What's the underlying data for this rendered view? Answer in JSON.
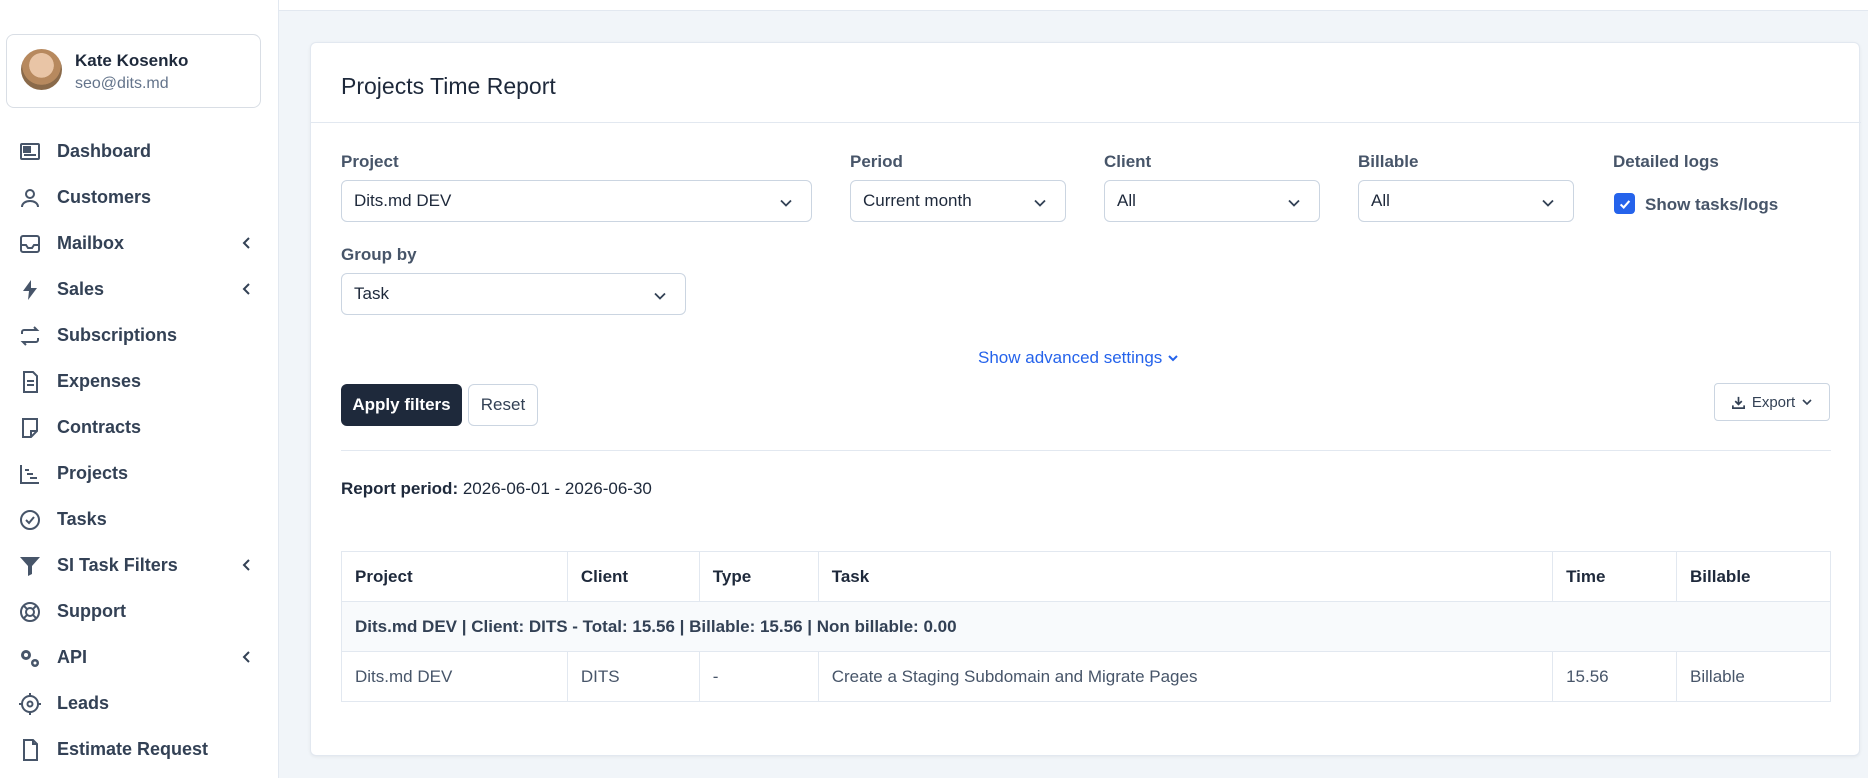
{
  "user": {
    "name": "Kate Kosenko",
    "email": "seo@dits.md"
  },
  "sidebar": {
    "items": [
      {
        "label": "Dashboard",
        "icon": "dashboard-icon",
        "has_submenu": false
      },
      {
        "label": "Customers",
        "icon": "user-icon",
        "has_submenu": false
      },
      {
        "label": "Mailbox",
        "icon": "envelope-icon",
        "has_submenu": true
      },
      {
        "label": "Sales",
        "icon": "bolt-icon",
        "has_submenu": true
      },
      {
        "label": "Subscriptions",
        "icon": "repeat-icon",
        "has_submenu": false
      },
      {
        "label": "Expenses",
        "icon": "document-icon",
        "has_submenu": false
      },
      {
        "label": "Contracts",
        "icon": "contract-icon",
        "has_submenu": false
      },
      {
        "label": "Projects",
        "icon": "chart-steps-icon",
        "has_submenu": false
      },
      {
        "label": "Tasks",
        "icon": "check-circle-icon",
        "has_submenu": false
      },
      {
        "label": "SI Task Filters",
        "icon": "filter-icon",
        "has_submenu": true
      },
      {
        "label": "Support",
        "icon": "lifebuoy-icon",
        "has_submenu": false
      },
      {
        "label": "API",
        "icon": "gears-icon",
        "has_submenu": true
      },
      {
        "label": "Leads",
        "icon": "crosshair-icon",
        "has_submenu": false
      },
      {
        "label": "Estimate Request",
        "icon": "file-icon",
        "has_submenu": false
      }
    ]
  },
  "report": {
    "title": "Projects Time Report",
    "filters": {
      "project": {
        "label": "Project",
        "value": "Dits.md DEV"
      },
      "period": {
        "label": "Period",
        "value": "Current month"
      },
      "client": {
        "label": "Client",
        "value": "All"
      },
      "billable": {
        "label": "Billable",
        "value": "All"
      },
      "detailed_logs": {
        "label": "Detailed logs",
        "checkbox_label": "Show tasks/logs",
        "checked": true
      },
      "group_by": {
        "label": "Group by",
        "value": "Task"
      }
    },
    "advanced_link": "Show advanced settings",
    "buttons": {
      "apply": "Apply filters",
      "reset": "Reset",
      "export": "Export"
    },
    "period_label": "Report period:",
    "period_value": "2026-06-01 - 2026-06-30",
    "table": {
      "columns": [
        "Project",
        "Client",
        "Type",
        "Task",
        "Time",
        "Billable"
      ],
      "group_row": "Dits.md DEV | Client: DITS - Total: 15.56 | Billable: 15.56 | Non billable: 0.00",
      "rows": [
        [
          "Dits.md DEV",
          "DITS",
          "-",
          "Create a Staging Subdomain and Migrate Pages",
          "15.56",
          "Billable"
        ]
      ]
    }
  },
  "colors": {
    "primary_dark": "#1e293b",
    "link_blue": "#2563eb",
    "page_bg": "#f1f5f9"
  }
}
